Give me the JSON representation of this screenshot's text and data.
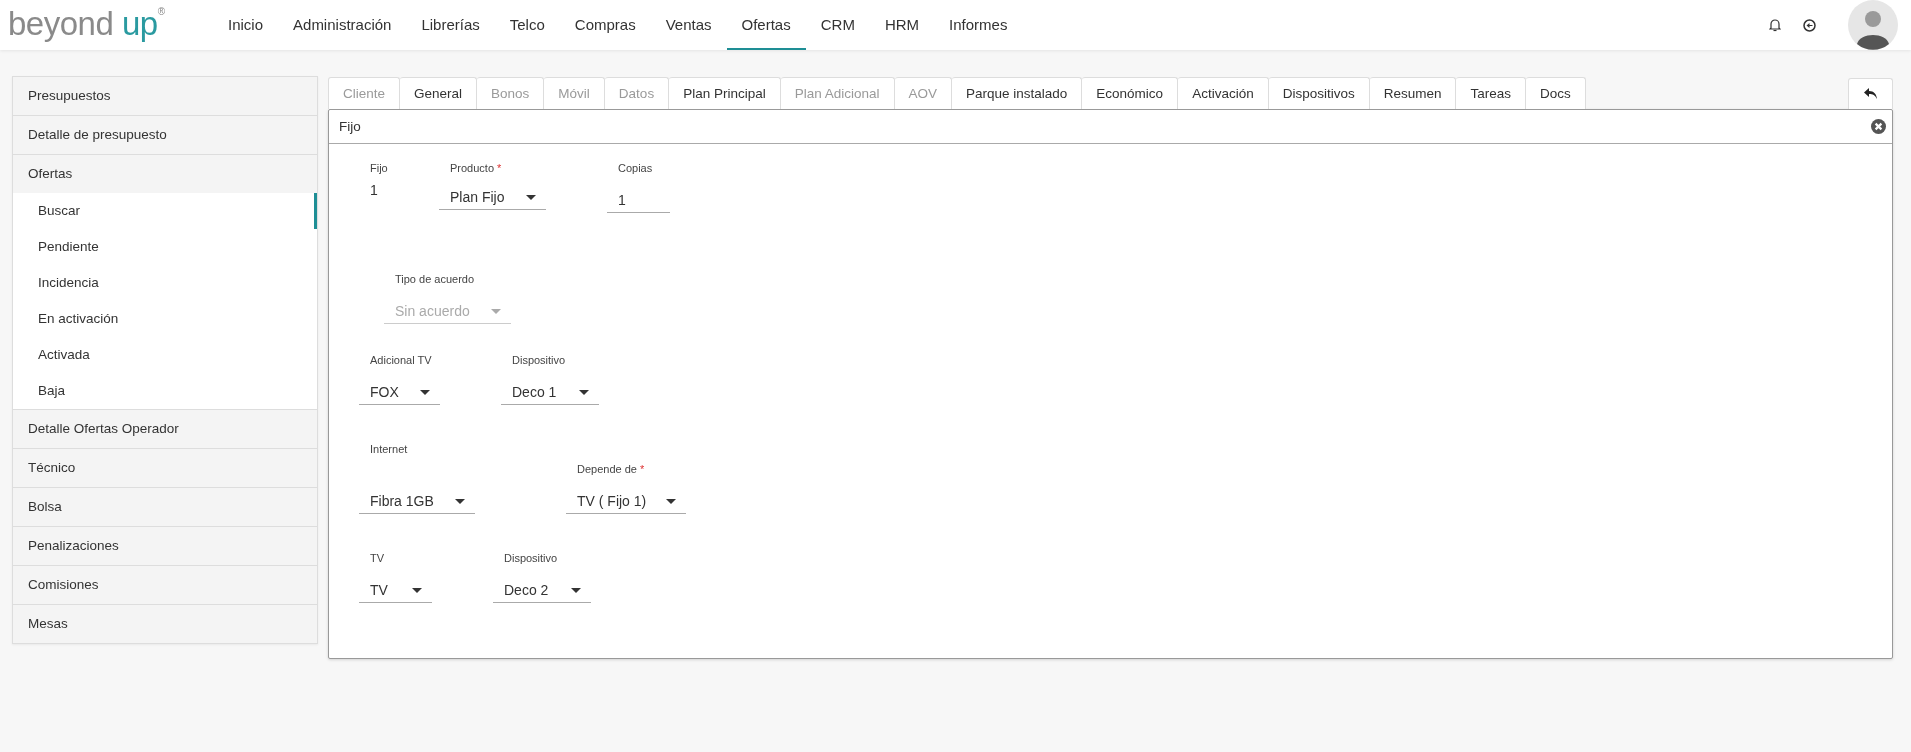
{
  "header": {
    "logo": {
      "word1": "beyond",
      "word2": "up",
      "mark": "®"
    },
    "nav": [
      {
        "label": "Inicio",
        "selected": false
      },
      {
        "label": "Administración",
        "selected": false
      },
      {
        "label": "Librerías",
        "selected": false
      },
      {
        "label": "Telco",
        "selected": false
      },
      {
        "label": "Compras",
        "selected": false
      },
      {
        "label": "Ventas",
        "selected": false
      },
      {
        "label": "Ofertas",
        "selected": true
      },
      {
        "label": "CRM",
        "selected": false
      },
      {
        "label": "HRM",
        "selected": false
      },
      {
        "label": "Informes",
        "selected": false
      }
    ]
  },
  "sidebar": {
    "items": [
      {
        "label": "Presupuestos"
      },
      {
        "label": "Detalle de presupuesto"
      },
      {
        "label": "Ofertas",
        "children": [
          {
            "label": "Buscar",
            "selected": true
          },
          {
            "label": "Pendiente",
            "selected": false
          },
          {
            "label": "Incidencia",
            "selected": false
          },
          {
            "label": "En activación",
            "selected": false
          },
          {
            "label": "Activada",
            "selected": false
          },
          {
            "label": "Baja",
            "selected": false
          }
        ]
      },
      {
        "label": "Detalle Ofertas Operador"
      },
      {
        "label": "Técnico"
      },
      {
        "label": "Bolsa"
      },
      {
        "label": "Penalizaciones"
      },
      {
        "label": "Comisiones"
      },
      {
        "label": "Mesas"
      }
    ]
  },
  "tabs": [
    {
      "label": "Cliente",
      "disabled": true
    },
    {
      "label": "General",
      "disabled": false
    },
    {
      "label": "Bonos",
      "disabled": true
    },
    {
      "label": "Móvil",
      "disabled": true
    },
    {
      "label": "Datos",
      "disabled": true
    },
    {
      "label": "Plan Principal",
      "disabled": false
    },
    {
      "label": "Plan Adicional",
      "disabled": true
    },
    {
      "label": "AOV",
      "disabled": true
    },
    {
      "label": "Parque instalado",
      "disabled": false
    },
    {
      "label": "Económico",
      "disabled": false
    },
    {
      "label": "Activación",
      "disabled": false
    },
    {
      "label": "Dispositivos",
      "disabled": false
    },
    {
      "label": "Resumen",
      "disabled": false
    },
    {
      "label": "Tareas",
      "disabled": false
    },
    {
      "label": "Docs",
      "disabled": false
    }
  ],
  "panel": {
    "title": "Fijo",
    "rows": [
      {
        "fields": [
          {
            "kind": "static",
            "label": "Fijo",
            "value": "1"
          },
          {
            "kind": "select",
            "label": "Producto",
            "required_mark": "*",
            "value": "Plan Fijo",
            "disabled": false
          },
          {
            "kind": "input",
            "label": "Copias",
            "value": "1",
            "disabled": false
          }
        ]
      },
      {
        "fields": [
          {
            "kind": "select",
            "label": "Tipo de acuerdo",
            "value": "Sin acuerdo",
            "disabled": true
          }
        ]
      },
      {
        "fields": [
          {
            "kind": "select",
            "label": "Adicional TV",
            "value": "FOX",
            "disabled": false
          },
          {
            "kind": "select",
            "label": "Dispositivo",
            "value": "Deco 1",
            "disabled": false
          }
        ]
      },
      {
        "fields": [
          {
            "kind": "select",
            "label": "Internet",
            "value": "Fibra 1GB",
            "disabled": false
          },
          {
            "kind": "select",
            "label": "Depende de",
            "required_mark": "*",
            "value": "TV ( Fijo 1)",
            "disabled": false
          }
        ]
      },
      {
        "fields": [
          {
            "kind": "select",
            "label": "TV",
            "value": "TV",
            "disabled": false
          },
          {
            "kind": "select",
            "label": "Dispositivo",
            "value": "Deco 2",
            "disabled": false
          }
        ]
      }
    ]
  }
}
